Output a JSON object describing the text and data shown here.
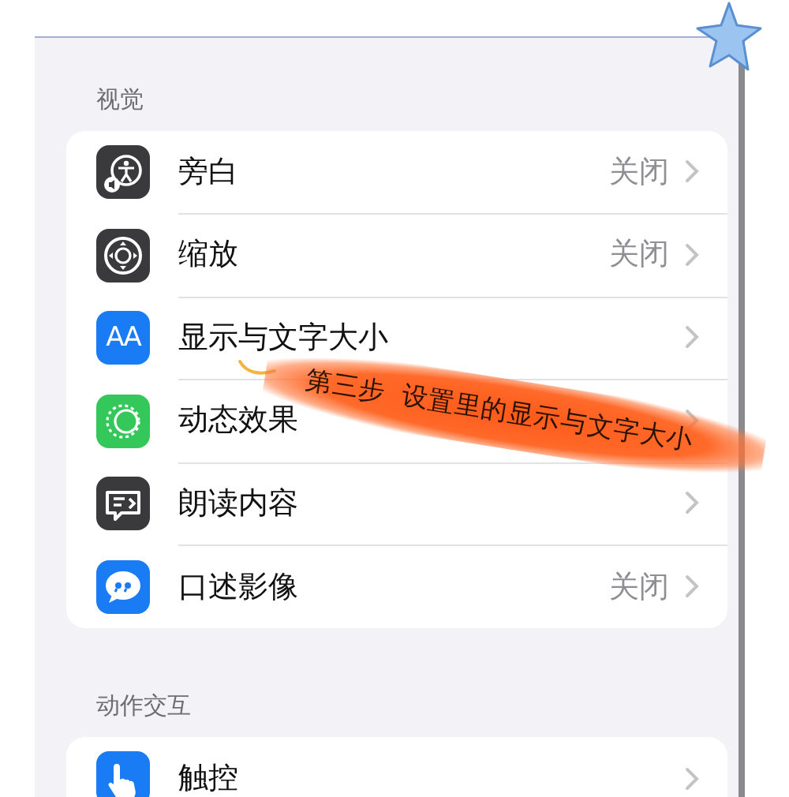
{
  "sections": [
    {
      "header": "视觉",
      "rows": [
        {
          "kind": "voiceover",
          "label": "旁白",
          "value": "关闭"
        },
        {
          "kind": "zoom",
          "label": "缩放",
          "value": "关闭"
        },
        {
          "kind": "display",
          "label": "显示与文字大小",
          "icon_text": "AA"
        },
        {
          "kind": "motion",
          "label": "动态效果"
        },
        {
          "kind": "spoken",
          "label": "朗读内容"
        },
        {
          "kind": "audio_description",
          "label": "口述影像",
          "value": "关闭"
        }
      ]
    },
    {
      "header": "动作交互",
      "rows": [
        {
          "kind": "touch",
          "label": "触控"
        }
      ]
    }
  ],
  "annotation": {
    "text": "第三步  设置里的显示与文字大小"
  }
}
